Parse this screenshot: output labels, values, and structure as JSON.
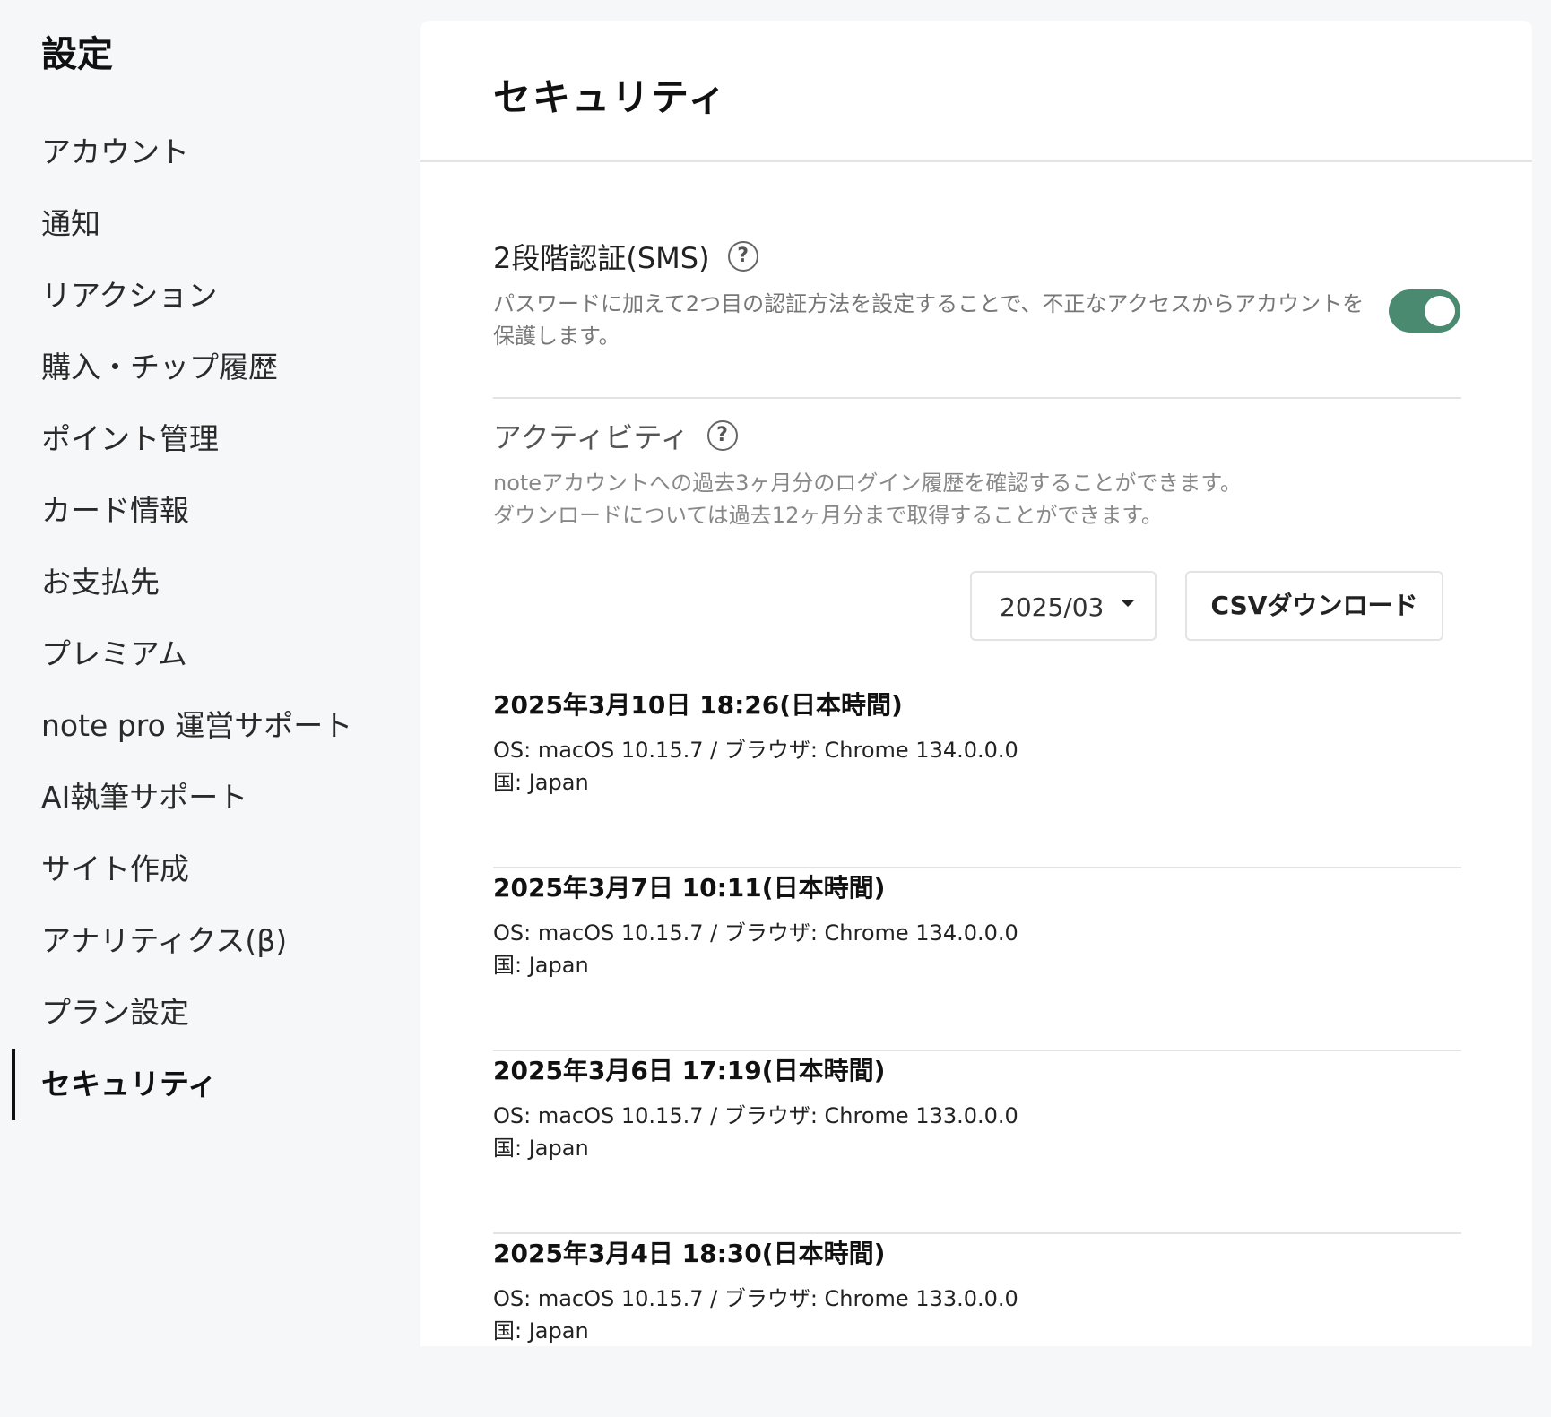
{
  "sidebar": {
    "title": "設定",
    "items": [
      {
        "label": "アカウント"
      },
      {
        "label": "通知"
      },
      {
        "label": "リアクション"
      },
      {
        "label": "購入・チップ履歴"
      },
      {
        "label": "ポイント管理"
      },
      {
        "label": "カード情報"
      },
      {
        "label": "お支払先"
      },
      {
        "label": "プレミアム"
      },
      {
        "label": "note pro 運営サポート"
      },
      {
        "label": "AI執筆サポート"
      },
      {
        "label": "サイト作成"
      },
      {
        "label": "アナリティクス(β)"
      },
      {
        "label": "プラン設定"
      },
      {
        "label": "セキュリティ"
      }
    ],
    "active_item": "セキュリティ"
  },
  "main": {
    "title": "セキュリティ",
    "sms": {
      "title": "2段階認証(SMS)",
      "description": "パスワードに加えて2つ目の認証方法を設定することで、不正なアクセスからアカウントを保護します。",
      "enabled": true,
      "toggle_color": "#4a8a71"
    },
    "activity": {
      "title": "アクティビティ",
      "description_line1": "noteアカウントへの過去3ヶ月分のログイン履歴を確認することができます。",
      "description_line2": "ダウンロードについては過去12ヶ月分まで取得することができます。",
      "month_selected": "2025/03",
      "csv_button": "CSVダウンロード",
      "logs": [
        {
          "date": "2025年3月10日 18:26(日本時間)",
          "os": "OS: macOS 10.15.7 / ブラウザ: Chrome 134.0.0.0",
          "country": "国: Japan"
        },
        {
          "date": "2025年3月7日 10:11(日本時間)",
          "os": "OS: macOS 10.15.7 / ブラウザ: Chrome 134.0.0.0",
          "country": "国: Japan"
        },
        {
          "date": "2025年3月6日 17:19(日本時間)",
          "os": "OS: macOS 10.15.7 / ブラウザ: Chrome 133.0.0.0",
          "country": "国: Japan"
        },
        {
          "date": "2025年3月4日 18:30(日本時間)",
          "os": "OS: macOS 10.15.7 / ブラウザ: Chrome 133.0.0.0",
          "country": "国: Japan"
        }
      ]
    }
  },
  "icons": {
    "help": "help-circle-icon",
    "dropdown": "caret-down-icon"
  }
}
